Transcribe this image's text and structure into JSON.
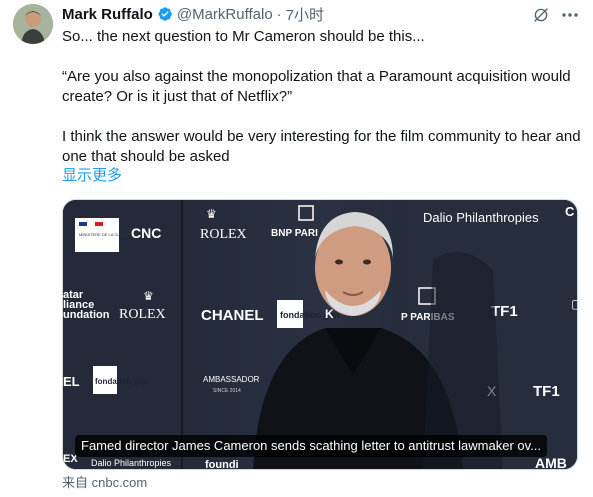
{
  "author": {
    "name": "Mark Ruffalo",
    "handle": "@MarkRuffalo",
    "separator": "·",
    "time": "7小时",
    "verified_color": "#1d9bf0"
  },
  "tweet": {
    "paragraphs": [
      "So... the next question to Mr Cameron should be this...",
      "“Are you also against the monopolization that a Paramount acquisition would create? Or is it just that of Netflix?”",
      "I think the answer would be very interesting for the film community to hear and one that should be asked"
    ],
    "show_more": "显示更多"
  },
  "media": {
    "caption": "Famed director James Cameron sends scathing letter to antitrust lawmaker ov...",
    "backdrop_logos": [
      "Dalio Philanthropies",
      "ROLEX",
      "BNP PARIBAS",
      "ROLEX",
      "CHANEL",
      "TF1",
      "TF1",
      "Dalio Philanthropies"
    ],
    "backdrop_partials": {
      "top_left_ministry": "MINISTÈRE DE LA CULTURE",
      "cnc": "CNC",
      "bnp_partial": "BNP PARI",
      "alliance": [
        "atar",
        "liance",
        "undation"
      ],
      "el": "EL",
      "gan_top": "fondation gan",
      "gan_bottom": "fondation gan",
      "ambassador": "AMBASSADOR",
      "ambassador_sub": "SINCE 2014",
      "partial_k": "K",
      "p_paribas": "P PARIBAS",
      "x_mark": "X",
      "ex": "EX",
      "dalio_bottom": "Dalio Philanthropies",
      "foundi": "foundi",
      "amb_right": "AMB",
      "c_top_right": "C"
    }
  },
  "source": {
    "label": "来自 cnbc.com"
  },
  "colors": {
    "text": "#0f1419",
    "secondary": "#536471",
    "link": "#1d9bf0"
  }
}
